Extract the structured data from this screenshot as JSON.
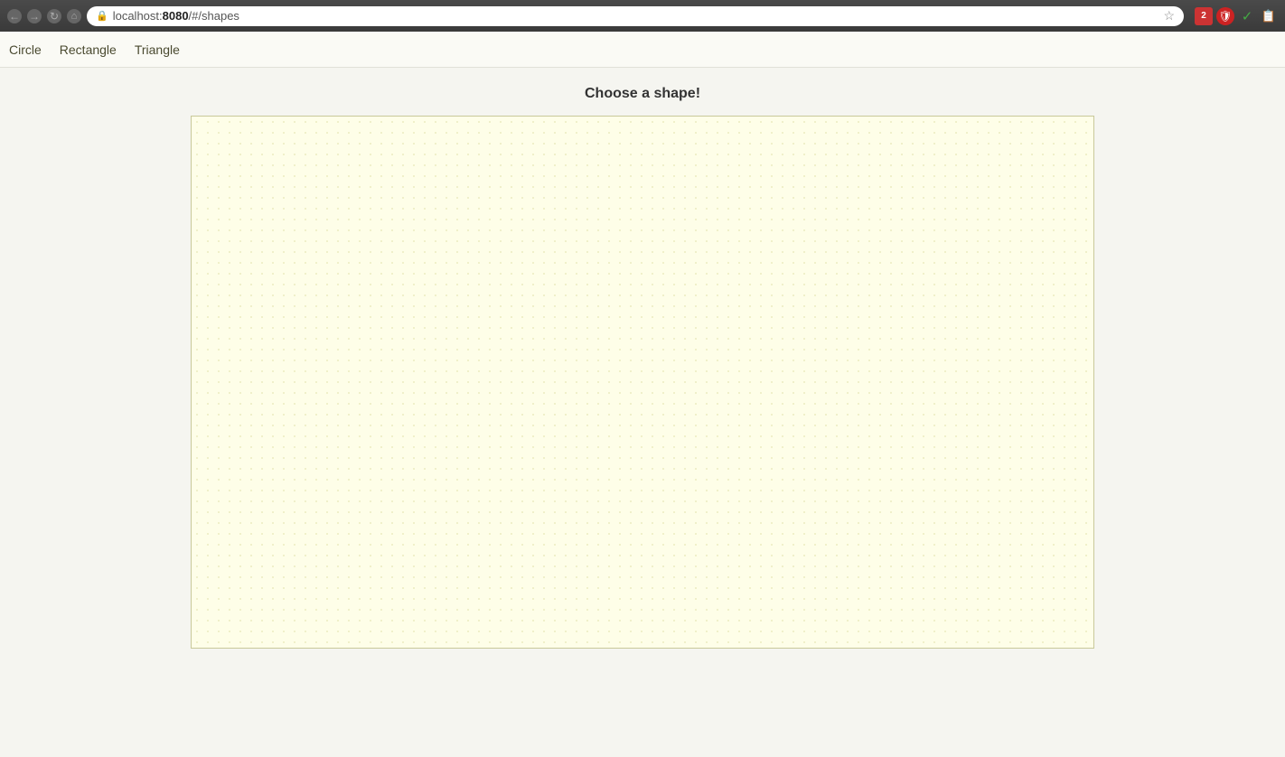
{
  "browser": {
    "back_button_label": "←",
    "forward_button_label": "→",
    "refresh_button_label": "↻",
    "home_button_label": "⌂",
    "url_prefix": "localhost:",
    "url_port": "8080",
    "url_path": "/#/shapes",
    "url_full": "localhost:8080/#/shapes",
    "star_icon": "☆",
    "extensions": [
      "🔴",
      "🛡",
      "✓",
      "📋"
    ]
  },
  "nav": {
    "items": [
      {
        "label": "Circle",
        "href": "#/shapes/circle"
      },
      {
        "label": "Rectangle",
        "href": "#/shapes/rectangle"
      },
      {
        "label": "Triangle",
        "href": "#/shapes/triangle"
      }
    ]
  },
  "main": {
    "heading": "Choose a shape!"
  }
}
